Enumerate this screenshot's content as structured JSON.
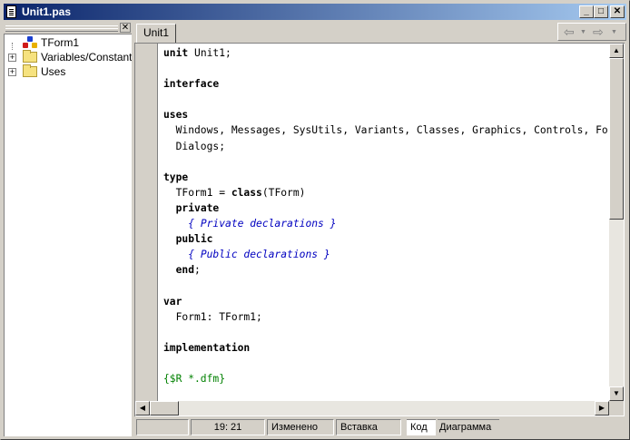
{
  "window": {
    "title": "Unit1.pas",
    "min_label": "_",
    "max_label": "□",
    "close_label": "✕"
  },
  "left_panel": {
    "close_label": "✕",
    "tree": [
      {
        "label": "TForm1",
        "icon": "class-icon",
        "expandable": false
      },
      {
        "label": "Variables/Constants",
        "icon": "folder-icon",
        "expandable": true,
        "expander": "+"
      },
      {
        "label": "Uses",
        "icon": "folder-icon",
        "expandable": true,
        "expander": "+"
      }
    ]
  },
  "editor": {
    "tab_label": "Unit1",
    "nav": {
      "back_icon": "arrow-left-icon",
      "forward_icon": "arrow-right-icon",
      "back": "⇦",
      "forward": "⇨",
      "drop": "▼"
    },
    "code_lines": [
      "unit Unit1;",
      "",
      "interface",
      "",
      "uses",
      "  Windows, Messages, SysUtils, Variants, Classes, Graphics, Controls, Forms,",
      "  Dialogs;",
      "",
      "type",
      "  TForm1 = class(TForm)",
      "  private",
      "    { Private declarations }",
      "  public",
      "    { Public declarations }",
      "  end;",
      "",
      "var",
      "  Form1: TForm1;",
      "",
      "implementation",
      "",
      "{$R *.dfm}"
    ],
    "scroll": {
      "up": "▲",
      "down": "▼",
      "left": "◀",
      "right": "▶"
    }
  },
  "statusbar": {
    "position": "19:  21",
    "modified": "Изменено",
    "mode": "Вставка",
    "tab_code": "Код",
    "tab_diagram": "Диаграмма"
  },
  "colors": {
    "title_gradient_start": "#0a246a",
    "title_gradient_end": "#a6caf0",
    "comment": "#0000c0",
    "directive": "#008000"
  }
}
